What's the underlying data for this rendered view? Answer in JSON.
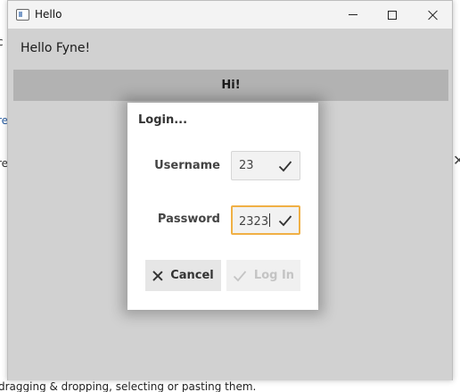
{
  "window": {
    "title": "Hello"
  },
  "content": {
    "hello_label": "Hello Fyne!",
    "hi_button": "Hi!"
  },
  "dialog": {
    "title": "Login...",
    "username_label": "Username",
    "username_value": "23",
    "password_label": "Password",
    "password_value": "2323",
    "cancel_label": "Cancel",
    "login_label": "Log In"
  },
  "background": {
    "left_fragment_1": "c",
    "left_fragment_2": "re",
    "left_fragment_3": "re",
    "bottom_text": "dragging & dropping, selecting or pasting them."
  },
  "colors": {
    "focus_border": "#f0b045",
    "overlay": "rgba(0,0,0,0.18)",
    "disabled_text": "#c4c4c4"
  }
}
